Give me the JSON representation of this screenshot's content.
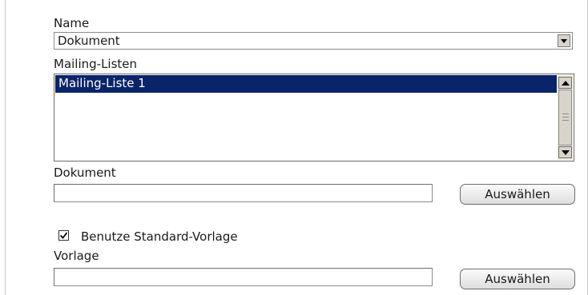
{
  "name_field": {
    "label": "Name",
    "selected": "Dokument"
  },
  "mailing_lists": {
    "label": "Mailing-Listen",
    "items": [
      "Mailing-Liste 1"
    ]
  },
  "document": {
    "label": "Dokument",
    "value": "",
    "button_label": "Auswählen"
  },
  "use_default_template": {
    "label": "Benutze Standard-Vorlage",
    "checked": true
  },
  "template": {
    "label": "Vorlage",
    "value": "",
    "button_label": "Auswählen"
  },
  "colors": {
    "selection": "#0a246a",
    "button_face": "#d8d4cc"
  }
}
